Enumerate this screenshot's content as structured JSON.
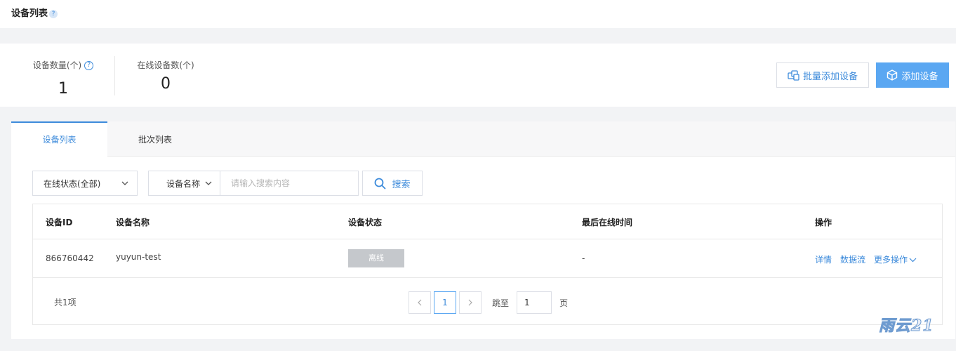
{
  "header": {
    "title": "设备列表",
    "help": "?"
  },
  "stats": {
    "device_count": {
      "label": "设备数量(个)",
      "value": "1",
      "help": "?"
    },
    "online_count": {
      "label": "在线设备数(个)",
      "value": "0"
    }
  },
  "actions": {
    "batch_add": "批量添加设备",
    "add": "添加设备",
    "batch_add_icon": "devices-icon",
    "add_icon": "cube-icon"
  },
  "tabs": [
    {
      "label": "设备列表",
      "active": true
    },
    {
      "label": "批次列表",
      "active": false
    }
  ],
  "filters": {
    "status_select": "在线状态(全部)",
    "field_select": "设备名称",
    "search_placeholder": "请输入搜索内容",
    "search_button": "搜索"
  },
  "table": {
    "columns": [
      "设备ID",
      "设备名称",
      "设备状态",
      "最后在线时间",
      "操作"
    ],
    "rows": [
      {
        "id": "866760442",
        "name": "yuyun-test",
        "status": "离线",
        "last_online": "-",
        "ops": {
          "detail": "详情",
          "stream": "数据流",
          "more": "更多操作"
        }
      }
    ]
  },
  "pagination": {
    "total": "共1项",
    "current_page": "1",
    "goto_label": "跳至",
    "goto_value": "1",
    "goto_unit": "页"
  },
  "watermark": "雨云21",
  "colors": {
    "accent": "#3d8bdb",
    "primary_button": "#5aa7f2",
    "offline_badge": "#c5c8cc"
  }
}
